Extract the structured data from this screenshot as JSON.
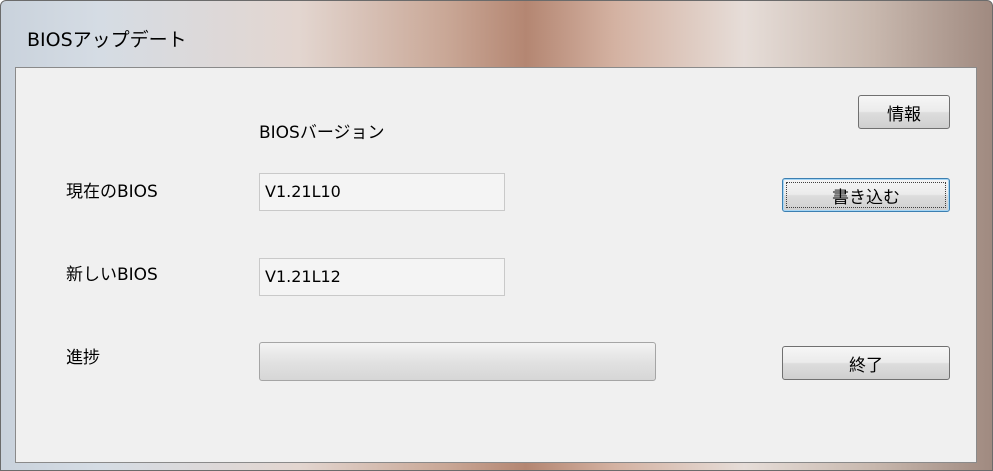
{
  "window": {
    "title": "BIOSアップデート"
  },
  "form": {
    "version_header": "BIOSバージョン",
    "current_label": "現在のBIOS",
    "current_value": "V1.21L10",
    "new_label": "新しいBIOS",
    "new_value": "V1.21L12",
    "progress_label": "進捗",
    "progress_value": 0
  },
  "buttons": {
    "info": "情報",
    "write": "書き込む",
    "exit": "終了"
  }
}
